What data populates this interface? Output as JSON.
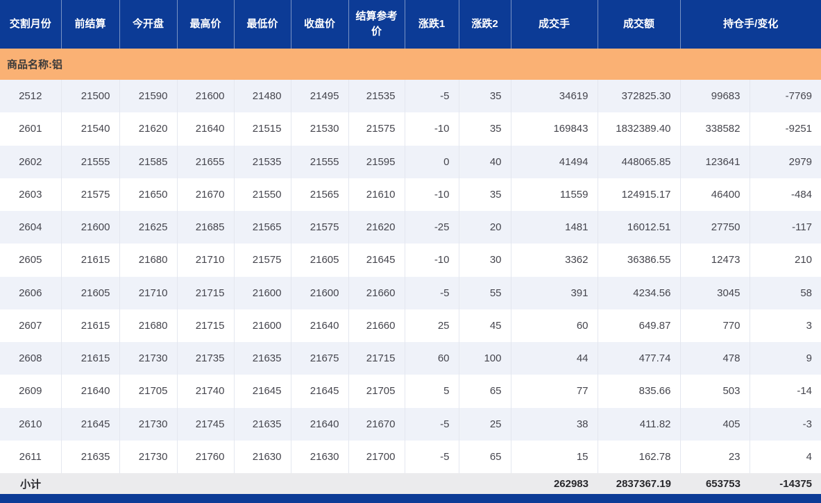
{
  "table": {
    "headers": [
      "交割月份",
      "前结算",
      "今开盘",
      "最高价",
      "最低价",
      "收盘价",
      "结算参考价",
      "涨跌1",
      "涨跌2",
      "成交手",
      "成交额",
      "持仓手/变化"
    ],
    "column_keys": [
      "month",
      "prev_settle",
      "open",
      "high",
      "low",
      "close",
      "settle_ref",
      "change1",
      "change2",
      "volume",
      "turnover",
      "open_interest",
      "oi_change"
    ],
    "section_label": "商品名称:铝",
    "rows": [
      [
        "2512",
        "21500",
        "21590",
        "21600",
        "21480",
        "21495",
        "21535",
        "-5",
        "35",
        "34619",
        "372825.30",
        "99683",
        "-7769"
      ],
      [
        "2601",
        "21540",
        "21620",
        "21640",
        "21515",
        "21530",
        "21575",
        "-10",
        "35",
        "169843",
        "1832389.40",
        "338582",
        "-9251"
      ],
      [
        "2602",
        "21555",
        "21585",
        "21655",
        "21535",
        "21555",
        "21595",
        "0",
        "40",
        "41494",
        "448065.85",
        "123641",
        "2979"
      ],
      [
        "2603",
        "21575",
        "21650",
        "21670",
        "21550",
        "21565",
        "21610",
        "-10",
        "35",
        "11559",
        "124915.17",
        "46400",
        "-484"
      ],
      [
        "2604",
        "21600",
        "21625",
        "21685",
        "21565",
        "21575",
        "21620",
        "-25",
        "20",
        "1481",
        "16012.51",
        "27750",
        "-117"
      ],
      [
        "2605",
        "21615",
        "21680",
        "21710",
        "21575",
        "21605",
        "21645",
        "-10",
        "30",
        "3362",
        "36386.55",
        "12473",
        "210"
      ],
      [
        "2606",
        "21605",
        "21710",
        "21715",
        "21600",
        "21600",
        "21660",
        "-5",
        "55",
        "391",
        "4234.56",
        "3045",
        "58"
      ],
      [
        "2607",
        "21615",
        "21680",
        "21715",
        "21600",
        "21640",
        "21660",
        "25",
        "45",
        "60",
        "649.87",
        "770",
        "3"
      ],
      [
        "2608",
        "21615",
        "21730",
        "21735",
        "21635",
        "21675",
        "21715",
        "60",
        "100",
        "44",
        "477.74",
        "478",
        "9"
      ],
      [
        "2609",
        "21640",
        "21705",
        "21740",
        "21645",
        "21645",
        "21705",
        "5",
        "65",
        "77",
        "835.66",
        "503",
        "-14"
      ],
      [
        "2610",
        "21645",
        "21730",
        "21745",
        "21635",
        "21640",
        "21670",
        "-5",
        "25",
        "38",
        "411.82",
        "405",
        "-3"
      ],
      [
        "2611",
        "21635",
        "21730",
        "21760",
        "21630",
        "21630",
        "21700",
        "-5",
        "65",
        "15",
        "162.78",
        "23",
        "4"
      ]
    ],
    "subtotal": {
      "label": "小计",
      "volume": "262983",
      "turnover": "2837367.19",
      "open_interest": "653753",
      "oi_change": "-14375"
    }
  },
  "colors": {
    "header_bg": "#0c3b96",
    "section_bg": "#fab174",
    "row_alt_bg": "#eff2f9",
    "subtotal_bg": "#ebebed",
    "data_text": "#45454d"
  }
}
